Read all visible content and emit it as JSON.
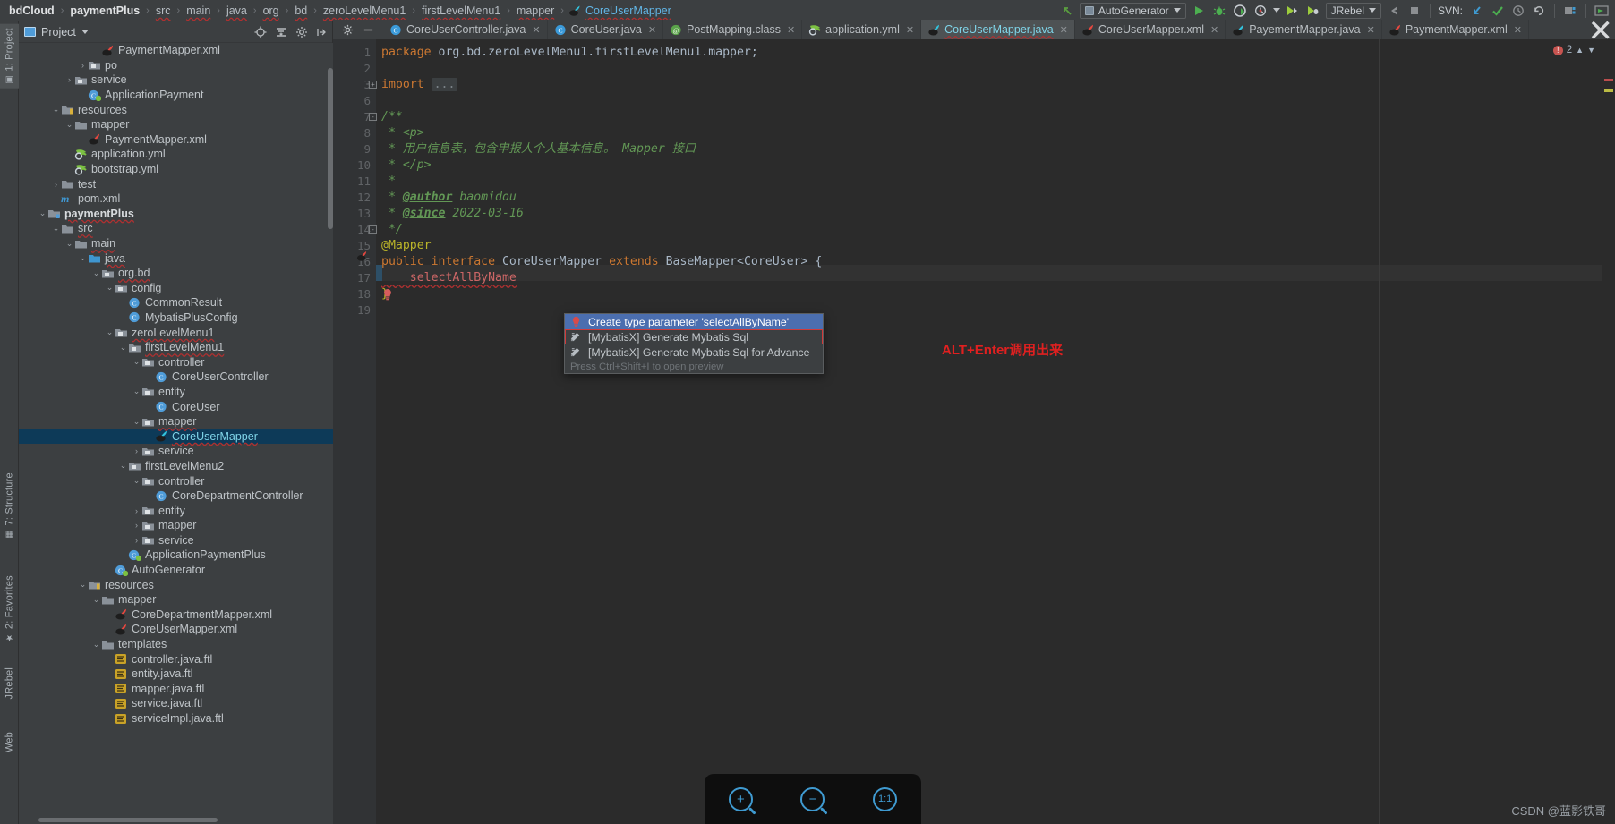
{
  "topbar": {
    "breadcrumbs": [
      {
        "label": "bdCloud",
        "style": "bold"
      },
      {
        "label": "paymentPlus",
        "style": "bold"
      },
      {
        "label": "src",
        "style": "err"
      },
      {
        "label": "main",
        "style": "err"
      },
      {
        "label": "java",
        "style": "err"
      },
      {
        "label": "org",
        "style": "err"
      },
      {
        "label": "bd",
        "style": "err"
      },
      {
        "label": "zeroLevelMenu1",
        "style": "err"
      },
      {
        "label": "firstLevelMenu1",
        "style": "err"
      },
      {
        "label": "mapper",
        "style": "err"
      },
      {
        "label": "CoreUserMapper",
        "style": "link"
      }
    ],
    "separator": "›",
    "run_config": "AutoGenerator",
    "jrebel_label": "JRebel",
    "svn_label": "SVN:",
    "icons": [
      "back-arrow-icon",
      "run-icon",
      "debug-icon",
      "coverage-icon",
      "profiler-icon",
      "jrebel-run-icon",
      "jrebel-debug-icon",
      "stop-icon",
      "svn-update-icon",
      "svn-commit-icon",
      "svn-history-icon",
      "svn-revert-icon",
      "project-structure-icon",
      "terminal-icon"
    ]
  },
  "left_tool_strip": [
    {
      "label": "1: Project",
      "active": true
    },
    {
      "label": "7: Structure",
      "active": false
    },
    {
      "label": "2: Favorites",
      "active": false
    },
    {
      "label": "JRebel",
      "active": false
    },
    {
      "label": "Web",
      "active": false
    }
  ],
  "project_panel": {
    "title": "Project",
    "header_icons": [
      "locate-icon",
      "collapse-all-icon",
      "settings-icon",
      "hide-icon"
    ],
    "tree": [
      {
        "indent": 5,
        "arrow": "",
        "icon": "mybatis-xml-icon",
        "label": "PaymentMapper.xml",
        "style": "",
        "selected": false
      },
      {
        "indent": 4,
        "arrow": "›",
        "icon": "package-icon",
        "label": "po",
        "style": "",
        "selected": false
      },
      {
        "indent": 3,
        "arrow": "›",
        "icon": "package-icon",
        "label": "service",
        "style": "",
        "selected": false
      },
      {
        "indent": 4,
        "arrow": "",
        "icon": "runnable-class-icon",
        "label": "ApplicationPayment",
        "style": "",
        "selected": false
      },
      {
        "indent": 2,
        "arrow": "⌄",
        "icon": "resources-folder-icon",
        "label": "resources",
        "style": "",
        "selected": false
      },
      {
        "indent": 3,
        "arrow": "⌄",
        "icon": "folder-icon",
        "label": "mapper",
        "style": "",
        "selected": false
      },
      {
        "indent": 4,
        "arrow": "",
        "icon": "mybatis-xml-icon",
        "label": "PaymentMapper.xml",
        "style": "",
        "selected": false
      },
      {
        "indent": 3,
        "arrow": "",
        "icon": "yml-icon",
        "label": "application.yml",
        "style": "",
        "selected": false
      },
      {
        "indent": 3,
        "arrow": "",
        "icon": "yml-icon",
        "label": "bootstrap.yml",
        "style": "",
        "selected": false
      },
      {
        "indent": 2,
        "arrow": "›",
        "icon": "folder-icon",
        "label": "test",
        "style": "",
        "selected": false
      },
      {
        "indent": 2,
        "arrow": "",
        "icon": "maven-icon",
        "label": "pom.xml",
        "style": "",
        "selected": false
      },
      {
        "indent": 1,
        "arrow": "⌄",
        "icon": "module-icon",
        "label": "paymentPlus",
        "style": "bold squiggle",
        "selected": false
      },
      {
        "indent": 2,
        "arrow": "⌄",
        "icon": "folder-icon",
        "label": "src",
        "style": "squiggle",
        "selected": false
      },
      {
        "indent": 3,
        "arrow": "⌄",
        "icon": "folder-icon",
        "label": "main",
        "style": "squiggle",
        "selected": false
      },
      {
        "indent": 4,
        "arrow": "⌄",
        "icon": "source-folder-icon",
        "label": "java",
        "style": "squiggle",
        "selected": false
      },
      {
        "indent": 5,
        "arrow": "⌄",
        "icon": "package-icon",
        "label": "org.bd",
        "style": "squiggle",
        "selected": false
      },
      {
        "indent": 6,
        "arrow": "⌄",
        "icon": "package-icon",
        "label": "config",
        "style": "",
        "selected": false
      },
      {
        "indent": 7,
        "arrow": "",
        "icon": "class-icon",
        "label": "CommonResult",
        "style": "",
        "selected": false
      },
      {
        "indent": 7,
        "arrow": "",
        "icon": "class-icon",
        "label": "MybatisPlusConfig",
        "style": "",
        "selected": false
      },
      {
        "indent": 6,
        "arrow": "⌄",
        "icon": "package-icon",
        "label": "zeroLevelMenu1",
        "style": "squiggle",
        "selected": false
      },
      {
        "indent": 7,
        "arrow": "⌄",
        "icon": "package-icon",
        "label": "firstLevelMenu1",
        "style": "squiggle",
        "selected": false
      },
      {
        "indent": 8,
        "arrow": "⌄",
        "icon": "package-icon",
        "label": "controller",
        "style": "",
        "selected": false
      },
      {
        "indent": 9,
        "arrow": "",
        "icon": "class-icon",
        "label": "CoreUserController",
        "style": "",
        "selected": false
      },
      {
        "indent": 8,
        "arrow": "⌄",
        "icon": "package-icon",
        "label": "entity",
        "style": "",
        "selected": false
      },
      {
        "indent": 9,
        "arrow": "",
        "icon": "class-icon",
        "label": "CoreUser",
        "style": "",
        "selected": false
      },
      {
        "indent": 8,
        "arrow": "⌄",
        "icon": "package-icon",
        "label": "mapper",
        "style": "squiggle",
        "selected": false
      },
      {
        "indent": 9,
        "arrow": "",
        "icon": "mybatis-interface-icon",
        "label": "CoreUserMapper",
        "style": "selected-file",
        "selected": true
      },
      {
        "indent": 8,
        "arrow": "›",
        "icon": "package-icon",
        "label": "service",
        "style": "",
        "selected": false
      },
      {
        "indent": 7,
        "arrow": "⌄",
        "icon": "package-icon",
        "label": "firstLevelMenu2",
        "style": "",
        "selected": false
      },
      {
        "indent": 8,
        "arrow": "⌄",
        "icon": "package-icon",
        "label": "controller",
        "style": "",
        "selected": false
      },
      {
        "indent": 9,
        "arrow": "",
        "icon": "class-icon",
        "label": "CoreDepartmentController",
        "style": "",
        "selected": false
      },
      {
        "indent": 8,
        "arrow": "›",
        "icon": "package-icon",
        "label": "entity",
        "style": "",
        "selected": false
      },
      {
        "indent": 8,
        "arrow": "›",
        "icon": "package-icon",
        "label": "mapper",
        "style": "",
        "selected": false
      },
      {
        "indent": 8,
        "arrow": "›",
        "icon": "package-icon",
        "label": "service",
        "style": "",
        "selected": false
      },
      {
        "indent": 7,
        "arrow": "",
        "icon": "runnable-class-icon",
        "label": "ApplicationPaymentPlus",
        "style": "",
        "selected": false
      },
      {
        "indent": 6,
        "arrow": "",
        "icon": "runnable-class-icon",
        "label": "AutoGenerator",
        "style": "",
        "selected": false
      },
      {
        "indent": 4,
        "arrow": "⌄",
        "icon": "resources-folder-icon",
        "label": "resources",
        "style": "",
        "selected": false
      },
      {
        "indent": 5,
        "arrow": "⌄",
        "icon": "folder-icon",
        "label": "mapper",
        "style": "",
        "selected": false
      },
      {
        "indent": 6,
        "arrow": "",
        "icon": "mybatis-xml-icon",
        "label": "CoreDepartmentMapper.xml",
        "style": "",
        "selected": false
      },
      {
        "indent": 6,
        "arrow": "",
        "icon": "mybatis-xml-icon",
        "label": "CoreUserMapper.xml",
        "style": "",
        "selected": false
      },
      {
        "indent": 5,
        "arrow": "⌄",
        "icon": "folder-icon",
        "label": "templates",
        "style": "",
        "selected": false
      },
      {
        "indent": 6,
        "arrow": "",
        "icon": "ftl-icon",
        "label": "controller.java.ftl",
        "style": "",
        "selected": false
      },
      {
        "indent": 6,
        "arrow": "",
        "icon": "ftl-icon",
        "label": "entity.java.ftl",
        "style": "",
        "selected": false
      },
      {
        "indent": 6,
        "arrow": "",
        "icon": "ftl-icon",
        "label": "mapper.java.ftl",
        "style": "",
        "selected": false
      },
      {
        "indent": 6,
        "arrow": "",
        "icon": "ftl-icon",
        "label": "service.java.ftl",
        "style": "",
        "selected": false
      },
      {
        "indent": 6,
        "arrow": "",
        "icon": "ftl-icon",
        "label": "serviceImpl.java.ftl",
        "style": "",
        "selected": false
      }
    ]
  },
  "editor_tabs": [
    {
      "label": "CoreUserController.java",
      "icon": "java-class-icon",
      "active": false
    },
    {
      "label": "CoreUser.java",
      "icon": "java-class-icon",
      "active": false
    },
    {
      "label": "PostMapping.class",
      "icon": "java-compiled-icon",
      "active": false
    },
    {
      "label": "application.yml",
      "icon": "yml-icon",
      "active": false
    },
    {
      "label": "CoreUserMapper.java",
      "icon": "mybatis-interface-icon",
      "active": true
    },
    {
      "label": "CoreUserMapper.xml",
      "icon": "mybatis-xml-icon",
      "active": false
    },
    {
      "label": "PayementMapper.java",
      "icon": "mybatis-interface-icon",
      "active": false
    },
    {
      "label": "PaymentMapper.xml",
      "icon": "mybatis-xml-icon",
      "active": false
    }
  ],
  "editor": {
    "warning_count": "2",
    "line_numbers": [
      "1",
      "2",
      "3",
      "6",
      "7",
      "8",
      "9",
      "10",
      "11",
      "12",
      "13",
      "14",
      "15",
      "16",
      "17",
      "18",
      "19"
    ],
    "code_lines": [
      {
        "n": "1",
        "segments": [
          {
            "t": "package",
            "c": "kw"
          },
          {
            "t": " org.bd.zeroLevelMenu1.firstLevelMenu1.mapper;",
            "c": "plain"
          }
        ]
      },
      {
        "n": "2",
        "segments": []
      },
      {
        "n": "3",
        "segments": [
          {
            "t": "import",
            "c": "kw"
          },
          {
            "t": " ",
            "c": "plain"
          },
          {
            "t": "...",
            "c": "folded"
          }
        ]
      },
      {
        "n": "6",
        "segments": []
      },
      {
        "n": "7",
        "segments": [
          {
            "t": "/**",
            "c": "cmt"
          }
        ]
      },
      {
        "n": "8",
        "segments": [
          {
            "t": " * <p>",
            "c": "cmt"
          }
        ]
      },
      {
        "n": "9",
        "segments": [
          {
            "t": " * 用户信息表，包含申报人个人基本信息。 Mapper 接口",
            "c": "cmt"
          }
        ]
      },
      {
        "n": "10",
        "segments": [
          {
            "t": " * </p>",
            "c": "cmt"
          }
        ]
      },
      {
        "n": "11",
        "segments": [
          {
            "t": " *",
            "c": "cmt"
          }
        ]
      },
      {
        "n": "12",
        "segments": [
          {
            "t": " * ",
            "c": "cmt"
          },
          {
            "t": "@author",
            "c": "cmt-tag"
          },
          {
            "t": " baomidou",
            "c": "cmt"
          }
        ]
      },
      {
        "n": "13",
        "segments": [
          {
            "t": " * ",
            "c": "cmt"
          },
          {
            "t": "@since",
            "c": "cmt-tag"
          },
          {
            "t": " 2022-03-16",
            "c": "cmt"
          }
        ]
      },
      {
        "n": "14",
        "segments": [
          {
            "t": " */",
            "c": "cmt"
          }
        ]
      },
      {
        "n": "15",
        "segments": [
          {
            "t": "@Mapper",
            "c": "ann"
          }
        ]
      },
      {
        "n": "16",
        "segments": [
          {
            "t": "public interface",
            "c": "kw"
          },
          {
            "t": " CoreUserMapper ",
            "c": "typ"
          },
          {
            "t": "extends",
            "c": "kw"
          },
          {
            "t": " BaseMapper<CoreUser> {",
            "c": "typ"
          }
        ]
      },
      {
        "n": "17",
        "segments": [
          {
            "t": "    selectAllByName",
            "c": "err"
          }
        ]
      },
      {
        "n": "18",
        "segments": [
          {
            "t": "}",
            "c": "ann"
          }
        ]
      },
      {
        "n": "19",
        "segments": []
      }
    ]
  },
  "popup": {
    "items": [
      {
        "label": "Create type parameter 'selectAllByName'",
        "icon": "bulb-icon",
        "state": "selected"
      },
      {
        "label": "[MybatisX] Generate Mybatis Sql",
        "icon": "mybatisx-icon",
        "state": "highlighted"
      },
      {
        "label": "[MybatisX] Generate Mybatis Sql for Advance",
        "icon": "mybatisx-icon",
        "state": "normal"
      }
    ],
    "hint": "Press Ctrl+Shift+I to open preview"
  },
  "annotation": {
    "text": "ALT+Enter调用出来",
    "color": "#e02020"
  },
  "zoom_widget": {
    "buttons": [
      {
        "name": "zoom-in-button",
        "glyph": "+"
      },
      {
        "name": "zoom-out-button",
        "glyph": "−"
      },
      {
        "name": "zoom-reset-button",
        "glyph": "1:1"
      }
    ]
  },
  "watermark": "CSDN @蓝影铁哥",
  "colors": {
    "accent": "#4b6eaf",
    "editor_bg": "#2b2b2b",
    "panel_bg": "#3c3f41",
    "selection": "#0d3a58",
    "annotation_red": "#e02020"
  }
}
